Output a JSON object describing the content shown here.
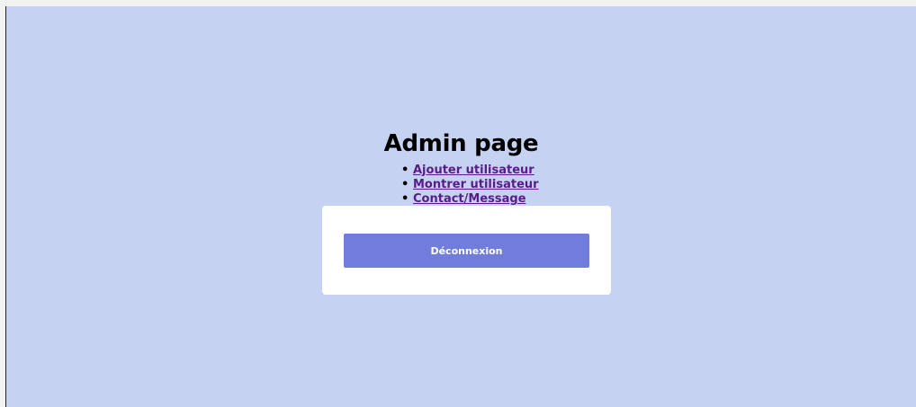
{
  "page": {
    "title": "Admin page",
    "background_color": "#c5d2f2"
  },
  "nav": {
    "links": [
      {
        "label": "Ajouter utilisateur"
      },
      {
        "label": "Montrer utilisateur"
      },
      {
        "label": "Contact/Message"
      }
    ],
    "link_color": "#5b1a8a"
  },
  "card": {
    "logout_label": "Déconnexion",
    "button_color": "#717dda"
  }
}
